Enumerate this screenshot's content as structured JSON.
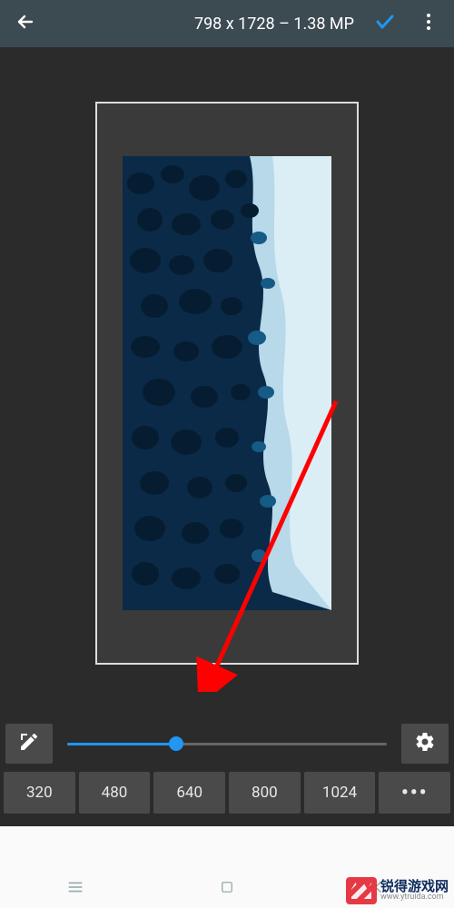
{
  "header": {
    "title": "798 x 1728 – 1.38 MP"
  },
  "slider": {
    "percent": 34
  },
  "presets": {
    "p0": "320",
    "p1": "480",
    "p2": "640",
    "p3": "800",
    "p4": "1024",
    "more": "•••"
  },
  "watermark": {
    "name": "锐得游戏网",
    "url": "www.ytruida.com"
  },
  "colors": {
    "accent": "#2196f3",
    "arrow": "#ff0000"
  }
}
